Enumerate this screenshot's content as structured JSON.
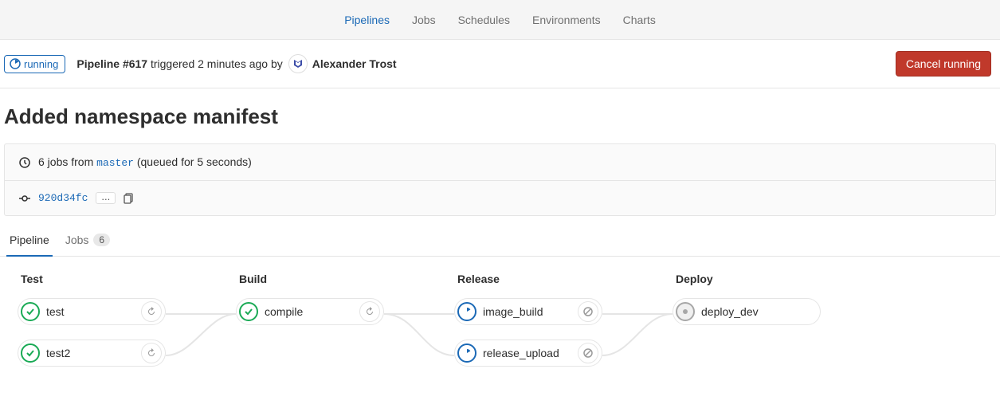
{
  "nav": {
    "items": [
      "Pipelines",
      "Jobs",
      "Schedules",
      "Environments",
      "Charts"
    ],
    "active_index": 0
  },
  "status": {
    "label": "running"
  },
  "header": {
    "pipeline_label": "Pipeline #617",
    "triggered_text": " triggered 2 minutes ago by ",
    "author": "Alexander Trost",
    "cancel_label": "Cancel running"
  },
  "commit": {
    "title": "Added namespace manifest"
  },
  "info": {
    "jobs_text_pre": "6 jobs from ",
    "branch": "master",
    "jobs_text_post": " (queued for 5 seconds)",
    "sha": "920d34fc",
    "ellipsis": "..."
  },
  "tabs": {
    "pipeline": "Pipeline",
    "jobs": "Jobs",
    "jobs_count": "6"
  },
  "stages": {
    "test": {
      "title": "Test",
      "jobs": [
        {
          "name": "test",
          "status": "success",
          "action": "retry"
        },
        {
          "name": "test2",
          "status": "success",
          "action": "retry"
        }
      ]
    },
    "build": {
      "title": "Build",
      "jobs": [
        {
          "name": "compile",
          "status": "success",
          "action": "retry"
        }
      ]
    },
    "release": {
      "title": "Release",
      "jobs": [
        {
          "name": "image_build",
          "status": "running",
          "action": "cancel"
        },
        {
          "name": "release_upload",
          "status": "running",
          "action": "cancel"
        }
      ]
    },
    "deploy": {
      "title": "Deploy",
      "jobs": [
        {
          "name": "deploy_dev",
          "status": "created",
          "action": "none"
        }
      ]
    }
  }
}
